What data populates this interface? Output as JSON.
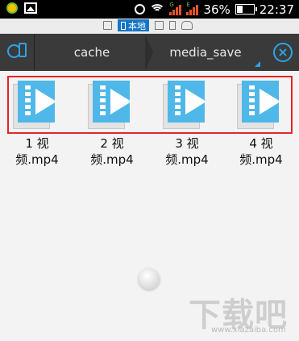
{
  "status_bar": {
    "battery_percent": "36%",
    "time": "22:37",
    "icons": [
      "app-badge-icon",
      "gallery-icon",
      "alarm-icon",
      "wifi-icon",
      "signal-icon",
      "battery-icon"
    ]
  },
  "location_bar": {
    "active_label": "本地",
    "icons": [
      "home-icon",
      "local-phone-icon",
      "list-icon",
      "cloud-icon"
    ]
  },
  "toolbar": {
    "breadcrumbs": [
      "cache",
      "media_save"
    ],
    "left_icon": "globe-phone-icon",
    "right_icon": "close-circle-icon"
  },
  "files": [
    {
      "name": "1 视频.mp4",
      "icon": "video-file-icon"
    },
    {
      "name": "2 视频.mp4",
      "icon": "video-file-icon"
    },
    {
      "name": "3 视频.mp4",
      "icon": "video-file-icon"
    },
    {
      "name": "4 视频.mp4",
      "icon": "video-file-icon"
    }
  ],
  "watermark": {
    "text": "下载吧",
    "url": "www.xiazaiba.com"
  },
  "colors": {
    "accent": "#2ea4e6",
    "selection": "#e5252a",
    "toolbar": "#3a3a3a"
  }
}
